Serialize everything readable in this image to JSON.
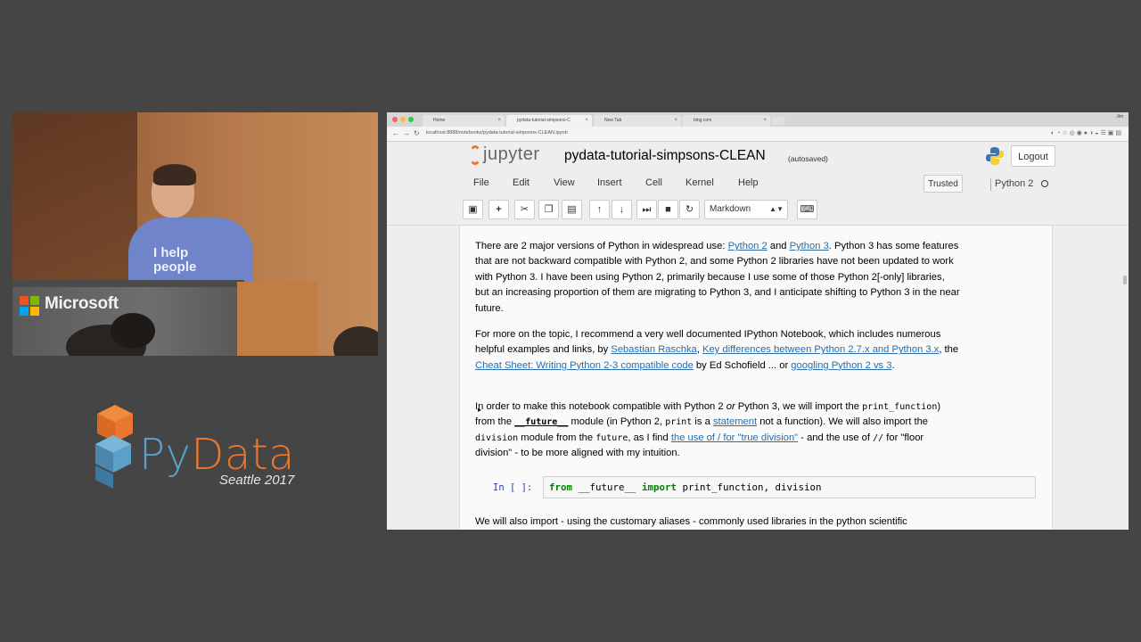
{
  "camera": {
    "shirt_line1": "I help",
    "shirt_line2": "people",
    "podium_brand": "Microsoft"
  },
  "event": {
    "logo_py": "Py",
    "logo_data": "Data",
    "subtitle": "Seattle 2017"
  },
  "browser": {
    "tabs": [
      {
        "label": "Home",
        "active": false
      },
      {
        "label": "pydata-tutorial-simpsons-C",
        "active": true
      },
      {
        "label": "New Tab",
        "active": false
      },
      {
        "label": "bing.com",
        "active": false
      }
    ],
    "user": "Jim",
    "url": "localhost:8888/notebooks/pydata-tutorial-simpsons-CLEAN.ipynb"
  },
  "jupyter": {
    "logo_text": "jupyter",
    "notebook_title": "pydata-tutorial-simpsons-CLEAN",
    "autosave_status": "(autosaved)",
    "logout_label": "Logout",
    "menu": [
      "File",
      "Edit",
      "View",
      "Insert",
      "Cell",
      "Kernel",
      "Help"
    ],
    "trusted_label": "Trusted",
    "kernel_name": "Python 2",
    "cell_type_select": "Markdown",
    "toolbar_icons": [
      "save-icon",
      "plus-icon",
      "scissors-icon",
      "copy-icon",
      "paste-icon",
      "arrow-up-icon",
      "arrow-down-icon",
      "step-forward-icon",
      "stop-icon",
      "refresh-icon",
      "keyboard-icon"
    ]
  },
  "notebook": {
    "p1": {
      "t1": "There are 2 major versions of Python in widespread use: ",
      "link1": "Python 2",
      "t2": " and ",
      "link2": "Python 3",
      "t3": ". Python 3 has some features that are not backward compatible with Python 2, and some Python 2 libraries have not been updated to work with Python 3. I have been using Python 2, primarily because I use some of those Python 2[-only] libraries, but an increasing proportion of them are migrating to Python 3, and I anticipate shifting to Python 3 in the near future."
    },
    "p2": {
      "t1": "For more on the topic, I recommend a very well documented IPython Notebook, which includes numerous helpful examples and links, by ",
      "link1": "Sebastian Raschka",
      "t2": ", ",
      "link2": "Key differences between Python 2.7.x and Python 3.x",
      "t3": ", the ",
      "link3": "Cheat Sheet: Writing Python 2-3 compatible code",
      "t4": " by Ed Schofield ... or ",
      "link4": "googling Python 2 vs 3",
      "t5": "."
    },
    "p3": {
      "t1": "In order to make this notebook compatible with Python 2 ",
      "em1": "or",
      "t2": " Python 3, we will import the ",
      "code1": "print_function",
      "t3": ") from the ",
      "code2": "__future__",
      "t4": " module (in Python 2, ",
      "code3": "print",
      "t5": " is a ",
      "link1": "statement",
      "t6": " not a function). We will also import the ",
      "code4": "division",
      "t7": " module from the ",
      "code5": "future",
      "t8": ", as I find ",
      "link2": "the use of / for \"true division\"",
      "t9": " - and the use of ",
      "code6": "//",
      "t10": " for \"floor division\" - to be more aligned with my intuition."
    },
    "code_cell": {
      "prompt": "In [ ]:",
      "kw1": "from",
      "mod": " __future__ ",
      "kw2": "import",
      "names": " print_function, division"
    },
    "p4": "We will also import - using the customary aliases - commonly used libraries in the python scientific"
  },
  "colors": {
    "background": "#454545",
    "pydata_orange": "#e9772f",
    "pydata_blue": "#5aa0c8",
    "jupyter_orange": "#f37726",
    "link": "#296eaa",
    "keyword_green": "#008000",
    "prompt_blue": "#303f9f"
  }
}
